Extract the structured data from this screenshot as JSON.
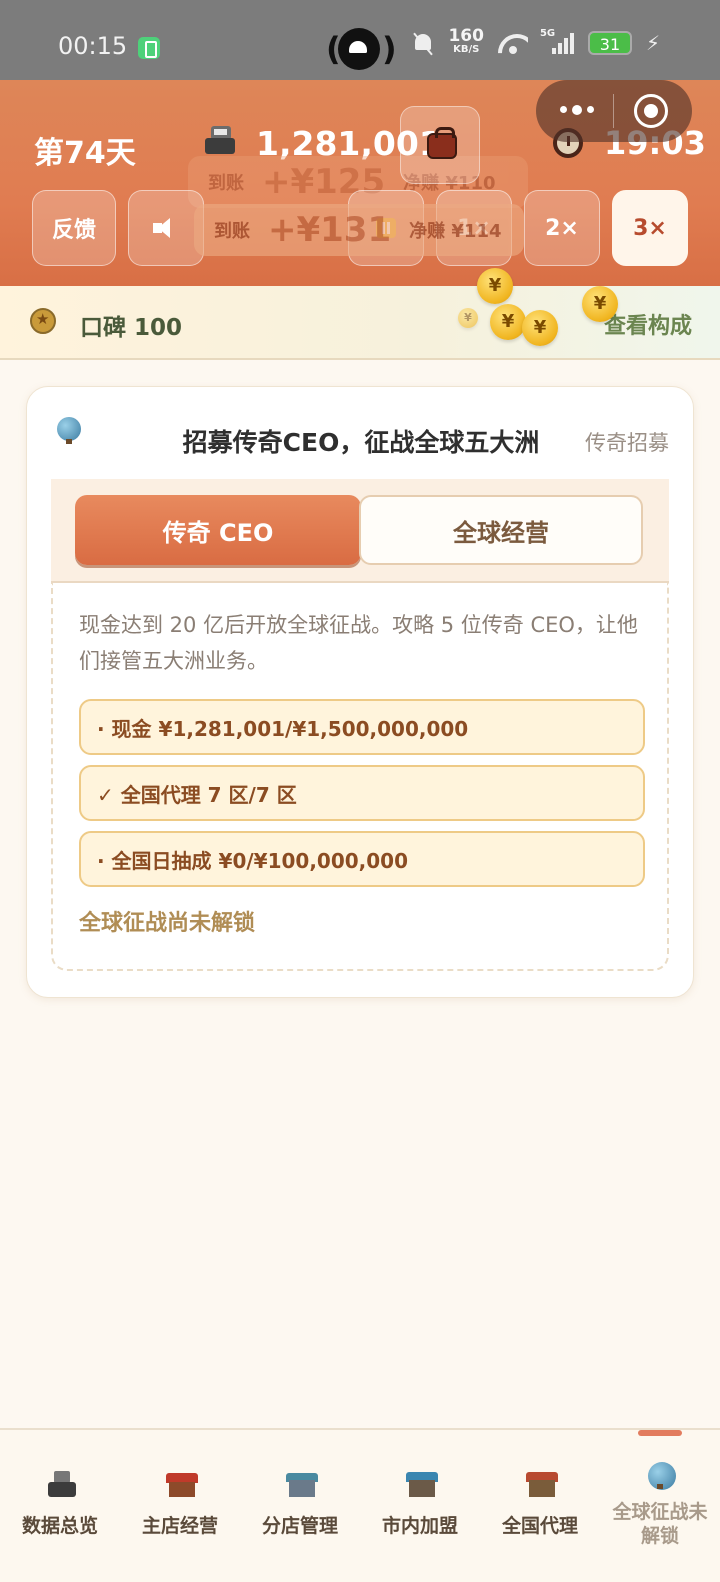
{
  "status_bar": {
    "time": "00:15",
    "net_speed": "160",
    "net_unit": "KB/S",
    "signal_label": "5G",
    "battery": "31"
  },
  "header": {
    "day": "第74天",
    "cash": "1,281,001",
    "timer": "19:03",
    "buttons": {
      "feedback": "反馈",
      "speed_1": "1×",
      "speed_2": "2×",
      "speed_3": "3×"
    },
    "toasts": [
      {
        "label": "到账",
        "amount": "+¥125",
        "net": "净赚 ¥110"
      },
      {
        "label": "到账",
        "amount": "+¥131",
        "net": "净赚 ¥114"
      }
    ]
  },
  "reputation": {
    "label": "口碑 100",
    "link": "查看构成",
    "coin_glyph": "¥"
  },
  "card": {
    "title": "招募传奇CEO，征战全球五大洲",
    "link": "传奇招募",
    "tabs": [
      {
        "label": "传奇 CEO",
        "active": true
      },
      {
        "label": "全球经营",
        "active": false
      }
    ],
    "description": "现金达到 20 亿后开放全球征战。攻略 5 位传奇 CEO，让他们接管五大洲业务。",
    "requirements": [
      "· 现金 ¥1,281,001/¥1,500,000,000",
      "✓ 全国代理 7 区/7 区",
      "· 全国日抽成 ¥0/¥100,000,000"
    ],
    "locked_text": "全球征战尚未解锁"
  },
  "bottom_nav": [
    {
      "label": "数据总览",
      "icon": "cash-register-icon"
    },
    {
      "label": "主店经营",
      "icon": "main-shop-icon"
    },
    {
      "label": "分店管理",
      "icon": "branch-shop-icon"
    },
    {
      "label": "市内加盟",
      "icon": "franchise-icon"
    },
    {
      "label": "全国代理",
      "icon": "national-agent-icon"
    },
    {
      "label": "全球征战未解锁",
      "icon": "globe-icon",
      "locked": true
    }
  ],
  "colors": {
    "header_orange": "#e07c51",
    "tab_active": "#d96c43",
    "requirement_border": "#eeca86",
    "requirement_text": "#8b4c22",
    "reputation_green": "#6b8550"
  }
}
